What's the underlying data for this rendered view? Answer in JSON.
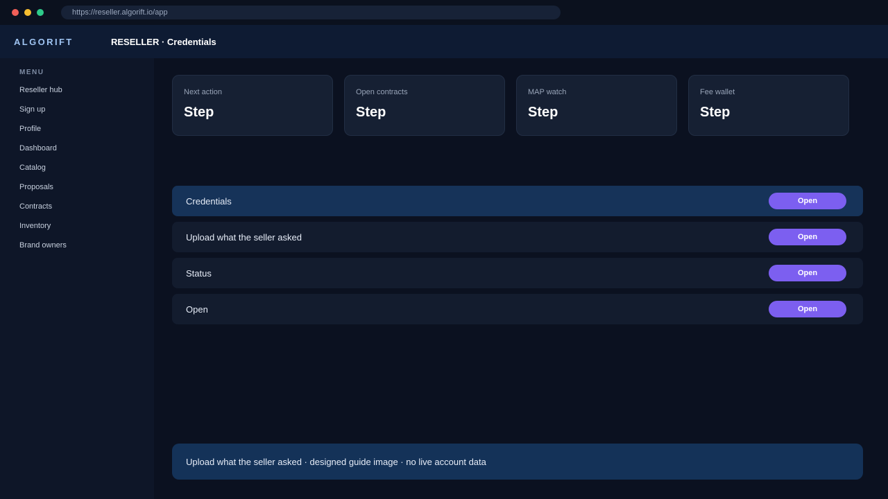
{
  "browser": {
    "url": "https://reseller.algorift.io/app"
  },
  "header": {
    "logo": "ALGORIFT",
    "title": "RESELLER · Credentials"
  },
  "sidebar": {
    "heading": "MENU",
    "items": [
      {
        "label": "Reseller hub"
      },
      {
        "label": "Sign up"
      },
      {
        "label": "Profile"
      },
      {
        "label": "Dashboard"
      },
      {
        "label": "Catalog"
      },
      {
        "label": "Proposals"
      },
      {
        "label": "Contracts"
      },
      {
        "label": "Inventory"
      },
      {
        "label": "Brand owners"
      }
    ]
  },
  "cards": [
    {
      "label": "Next action",
      "value": "Step"
    },
    {
      "label": "Open contracts",
      "value": "Step"
    },
    {
      "label": "MAP watch",
      "value": "Step"
    },
    {
      "label": "Fee wallet",
      "value": "Step"
    }
  ],
  "rows": [
    {
      "label": "Credentials",
      "button": "Open"
    },
    {
      "label": "Upload what the seller asked",
      "button": "Open"
    },
    {
      "label": "Status",
      "button": "Open"
    },
    {
      "label": "Open",
      "button": "Open"
    }
  ],
  "footer": {
    "text": "Upload what the seller asked · designed guide image · no live account data"
  },
  "colors": {
    "accent": "#7c5ff0",
    "active_row": "#163359",
    "logo": "#9fc4f2"
  }
}
